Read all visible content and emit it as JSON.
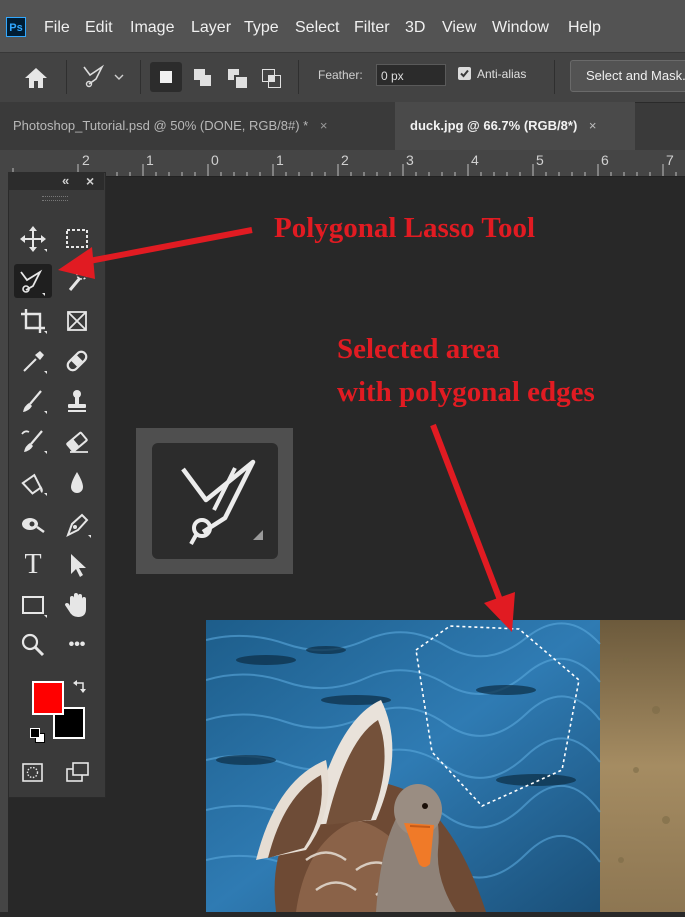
{
  "app": {
    "logo": "Ps"
  },
  "menu": [
    "File",
    "Edit",
    "Image",
    "Layer",
    "Type",
    "Select",
    "Filter",
    "3D",
    "View",
    "Window",
    "Help"
  ],
  "options_bar": {
    "feather_label": "Feather:",
    "feather_value": "0 px",
    "antialias_label": "Anti-alias",
    "antialias_checked": true,
    "select_mask_label": "Select and Mask..."
  },
  "tabs": [
    {
      "label": "Photoshop_Tutorial.psd @ 50% (DONE, RGB/8#) *",
      "active": false
    },
    {
      "label": "duck.jpg @ 66.7% (RGB/8*)",
      "active": true
    }
  ],
  "tab_close_glyph": "×",
  "ruler": [
    "2",
    "1",
    "0",
    "1",
    "2",
    "3",
    "4",
    "5",
    "6",
    "7"
  ],
  "toolbar": {
    "collapse_glyph": "«",
    "close_glyph": "×",
    "tools": [
      "move-icon",
      "marquee-icon",
      "polygonal-lasso-icon",
      "quick-select-icon",
      "crop-icon",
      "frame-icon",
      "eyedropper-icon",
      "healing-brush-icon",
      "brush-icon",
      "stamp-icon",
      "history-brush-icon",
      "eraser-icon",
      "paint-bucket-icon",
      "blur-icon",
      "dodge-icon",
      "pen-icon",
      "type-icon",
      "path-select-icon",
      "rectangle-icon",
      "hand-icon",
      "zoom-icon",
      "more-icon"
    ],
    "text_tool_glyph": "T",
    "more_glyph": "•••",
    "foreground_color": "#ff0000",
    "background_color": "#000000"
  },
  "annotations": {
    "title": "Polygonal Lasso Tool",
    "selected_line1": "Selected area",
    "selected_line2": "with polygonal edges",
    "color": "#e11b22"
  }
}
